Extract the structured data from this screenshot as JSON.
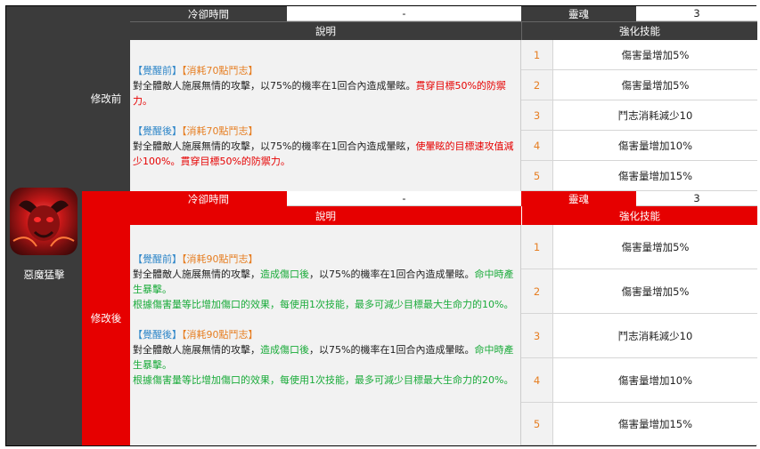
{
  "skill": {
    "name": "惡魔猛擊",
    "icon": "demon-skill-icon"
  },
  "labels": {
    "cooldown": "冷卻時間",
    "soul": "靈魂",
    "description": "說明",
    "enhance": "強化技能"
  },
  "before": {
    "version_label": "修改前",
    "cooldown_value": "-",
    "soul_value": "3",
    "pre_awaken": {
      "tag": "【覺醒前】",
      "cost": "【消耗70點鬥志】",
      "line_normal": "對全體敵人施展無情的攻擊，以75%的機率在1回合內造成暈眩。",
      "line_red": "貫穿目標50%的防禦力。"
    },
    "post_awaken": {
      "tag": "【覺醒後】",
      "cost": "【消耗70點鬥志】",
      "line_normal": "對全體敵人施展無情的攻擊，以75%的機率在1回合內造成暈眩，",
      "line_red": "使暈眩的目標速攻值減少100%。貫穿目標50%的防禦力。"
    },
    "enhancements": [
      {
        "num": "1",
        "text": "傷害量增加5%"
      },
      {
        "num": "2",
        "text": "傷害量增加5%"
      },
      {
        "num": "3",
        "text": "鬥志消耗減少10"
      },
      {
        "num": "4",
        "text": "傷害量增加10%"
      },
      {
        "num": "5",
        "text": "傷害量增加15%"
      }
    ]
  },
  "after": {
    "version_label": "修改後",
    "cooldown_value": "-",
    "soul_value": "3",
    "pre_awaken": {
      "tag": "【覺醒前】",
      "cost": "【消耗90點鬥志】",
      "line_a": "對全體敵人施展無情的攻擊，",
      "line_b_green": "造成傷口後",
      "line_c": "，以75%的機率在1回合內造成暈眩。",
      "line_d_green": "命中時產生暴擊。",
      "line_e_green": "根據傷害量等比增加傷口的效果，每使用1次技能，最多可減少目標最大生命力的10%。"
    },
    "post_awaken": {
      "tag": "【覺醒後】",
      "cost": "【消耗90點鬥志】",
      "line_a": "對全體敵人施展無情的攻擊，",
      "line_b_green": "造成傷口後",
      "line_c": "，以75%的機率在1回合內造成暈眩。",
      "line_d_green": "命中時產生暴擊。",
      "line_e_green": "根據傷害量等比增加傷口的效果，每使用1次技能，最多可減少目標最大生命力的20%。"
    },
    "enhancements": [
      {
        "num": "1",
        "text": "傷害量增加5%"
      },
      {
        "num": "2",
        "text": "傷害量增加5%"
      },
      {
        "num": "3",
        "text": "鬥志消耗減少10"
      },
      {
        "num": "4",
        "text": "傷害量增加10%"
      },
      {
        "num": "5",
        "text": "傷害量增加15%"
      }
    ]
  }
}
